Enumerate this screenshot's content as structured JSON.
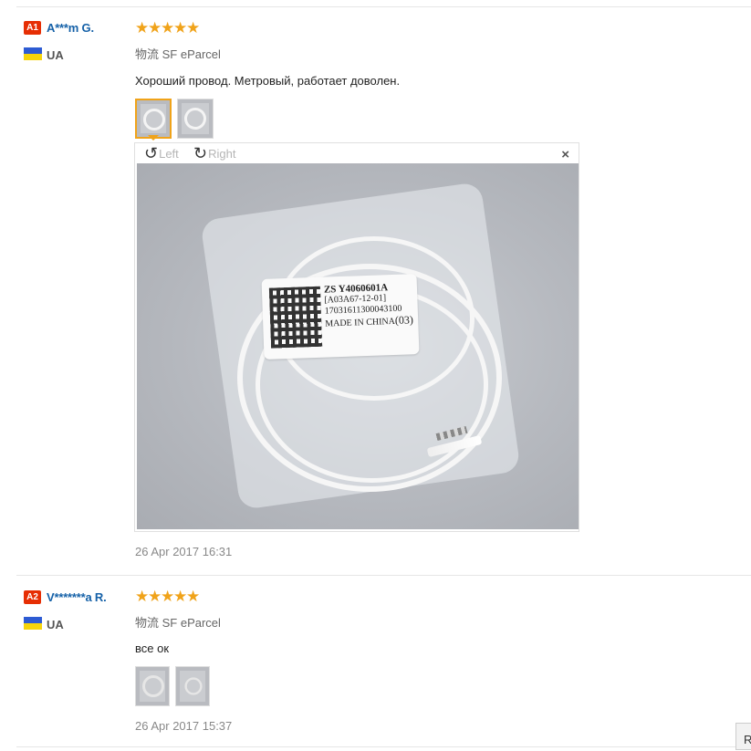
{
  "reviews": [
    {
      "buyer": {
        "level": "A1",
        "name": "A***m G.",
        "country": "UA"
      },
      "rating": 5,
      "shipping": "物流 SF eParcel",
      "feedback": "Хороший провод. Метровый, работает доволен.",
      "photos": [
        "photo-1",
        "photo-2"
      ],
      "viewer": {
        "rotate_left": "Left",
        "rotate_right": "Right",
        "close": "×",
        "sticker_lines": [
          "ZS Y4060601A",
          "[A03A67-12-01]",
          "17031611300043100",
          "MADE IN CHINA",
          "(03)"
        ]
      },
      "date": "26 Apr 2017 16:31"
    },
    {
      "buyer": {
        "level": "A2",
        "name": "V*******a R.",
        "country": "UA"
      },
      "rating": 5,
      "shipping": "物流 SF eParcel",
      "feedback": "все ок",
      "photos": [
        "photo-1",
        "photo-2"
      ],
      "date": "26 Apr 2017 15:37"
    }
  ],
  "colors": {
    "badge": "#e62e04",
    "buyer_name": "#1561a8",
    "stars": "#f0a31a",
    "flag_blue": "#2d5bd3",
    "flag_yellow": "#f6d40a"
  },
  "icons": {
    "star": "★",
    "rotate_left": "↺",
    "rotate_right": "↻"
  },
  "corner_button": "R"
}
